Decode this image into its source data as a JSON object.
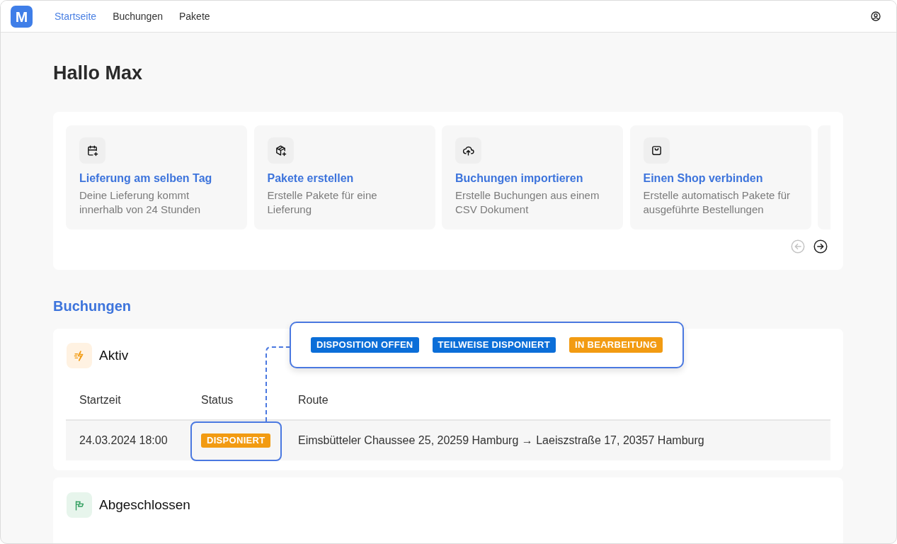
{
  "logo": {
    "mark": "M"
  },
  "nav": [
    {
      "label": "Startseite",
      "selected": true
    },
    {
      "label": "Buchungen",
      "selected": false
    },
    {
      "label": "Pakete",
      "selected": false
    }
  ],
  "greeting": "Hallo Max",
  "quick_actions": {
    "cards": [
      {
        "title": "Lieferung am selben Tag",
        "description": "Deine Lieferung kommt innerhalb von 24 Stunden"
      },
      {
        "title": "Pakete erstellen",
        "description": "Erstelle Pakete für eine Lieferung"
      },
      {
        "title": "Buchungen importieren",
        "description": "Erstelle Buchungen aus einem CSV Dokument"
      },
      {
        "title": "Einen Shop verbinden",
        "description": "Erstelle automatisch Pakete für ausgeführte Bestellungen"
      }
    ],
    "pager": [
      {
        "kind": "prev",
        "disabled": true
      },
      {
        "kind": "next",
        "disabled": false
      }
    ]
  },
  "bookings": {
    "title": "Buchungen",
    "sections": [
      {
        "kind": "active",
        "title": "Aktiv",
        "table": {
          "columns": [
            "Startzeit",
            "Status",
            "Route"
          ],
          "rows": [
            {
              "start": "24.03.2024 18:00",
              "status": {
                "label": "DISPONIERT",
                "color": "#f29b12",
                "highlighted": true
              },
              "route": "Eimsbütteler Chaussee 25, 20259 Hamburg → Laeiszstraße 17, 20357 Hamburg"
            }
          ]
        },
        "status_legend": [
          {
            "label": "DISPOSITION OFFEN",
            "color": "#0b6ed8"
          },
          {
            "label": "TEILWEISE DISPONIERT",
            "color": "#0b6ed8"
          },
          {
            "label": "IN BEARBEITUNG",
            "color": "#f29b12"
          }
        ]
      },
      {
        "kind": "completed",
        "title": "Abgeschlossen"
      }
    ]
  }
}
